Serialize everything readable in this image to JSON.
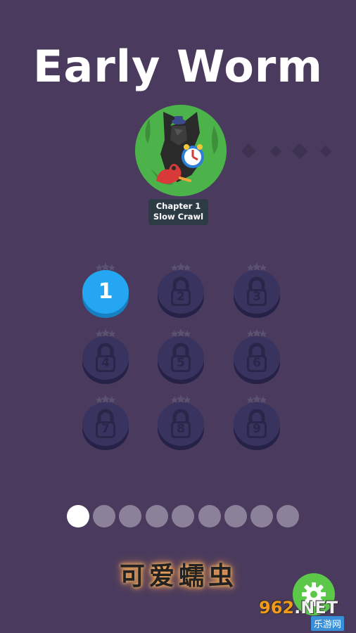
{
  "game": {
    "title": "Early Worm"
  },
  "chapter": {
    "label_line1": "Chapter 1",
    "label_line2": "Slow Crawl",
    "thumbnail": "chapter-1-thumbnail-icon",
    "total_chapters_shown": 5
  },
  "levels": [
    {
      "number": "1",
      "locked": false,
      "stars": 3
    },
    {
      "number": "2",
      "locked": true,
      "stars": 3
    },
    {
      "number": "3",
      "locked": true,
      "stars": 3
    },
    {
      "number": "4",
      "locked": true,
      "stars": 3
    },
    {
      "number": "5",
      "locked": true,
      "stars": 3
    },
    {
      "number": "6",
      "locked": true,
      "stars": 3
    },
    {
      "number": "7",
      "locked": true,
      "stars": 3
    },
    {
      "number": "8",
      "locked": true,
      "stars": 3
    },
    {
      "number": "9",
      "locked": true,
      "stars": 3
    }
  ],
  "pagination": {
    "total_pages": 9,
    "current_page": 1
  },
  "watermark": {
    "caption": "可爱蠕虫",
    "site_name_prefix": "962",
    "site_name_suffix": ".NET",
    "site_sub": "乐游网"
  },
  "colors": {
    "background": "#4a3b5e",
    "unlocked_level": "#24a6f2",
    "locked_level": "#38335f",
    "settings_button": "#5cc84a"
  },
  "icons": {
    "settings": "gear-icon",
    "lock": "lock-icon",
    "star": "star-icon"
  }
}
